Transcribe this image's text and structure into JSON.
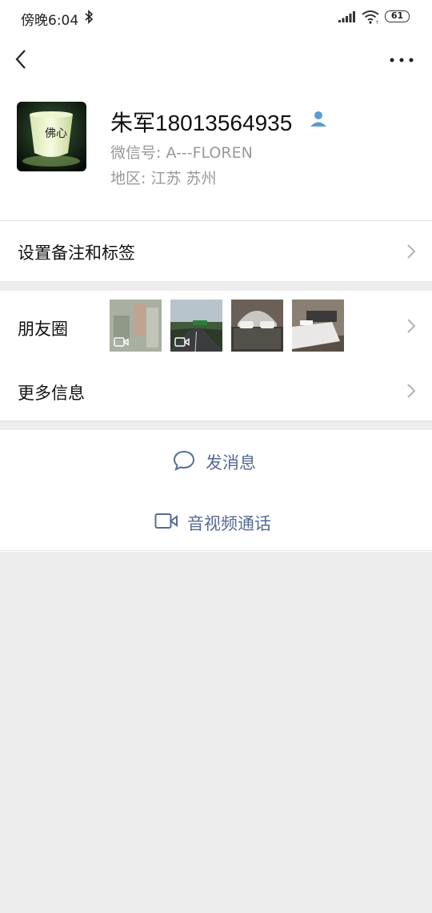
{
  "status_bar": {
    "time": "傍晚6:04",
    "battery": "61"
  },
  "nav": {
    "back_icon": "chevron-left-icon",
    "more_icon": "more-dots-icon"
  },
  "profile": {
    "name": "朱军18013564935",
    "wechat_id": "微信号: A---FLOREN",
    "region": "地区: 江苏  苏州",
    "avatar_text": "佛心"
  },
  "rows": {
    "remark_label": "设置备注和标签",
    "moments_label": "朋友圈",
    "more_info_label": "更多信息"
  },
  "actions": {
    "message_label": "发消息",
    "call_label": "音视频通话"
  },
  "colors": {
    "link": "#576b95",
    "background": "#ededed",
    "verified": "#5b9bd5"
  }
}
